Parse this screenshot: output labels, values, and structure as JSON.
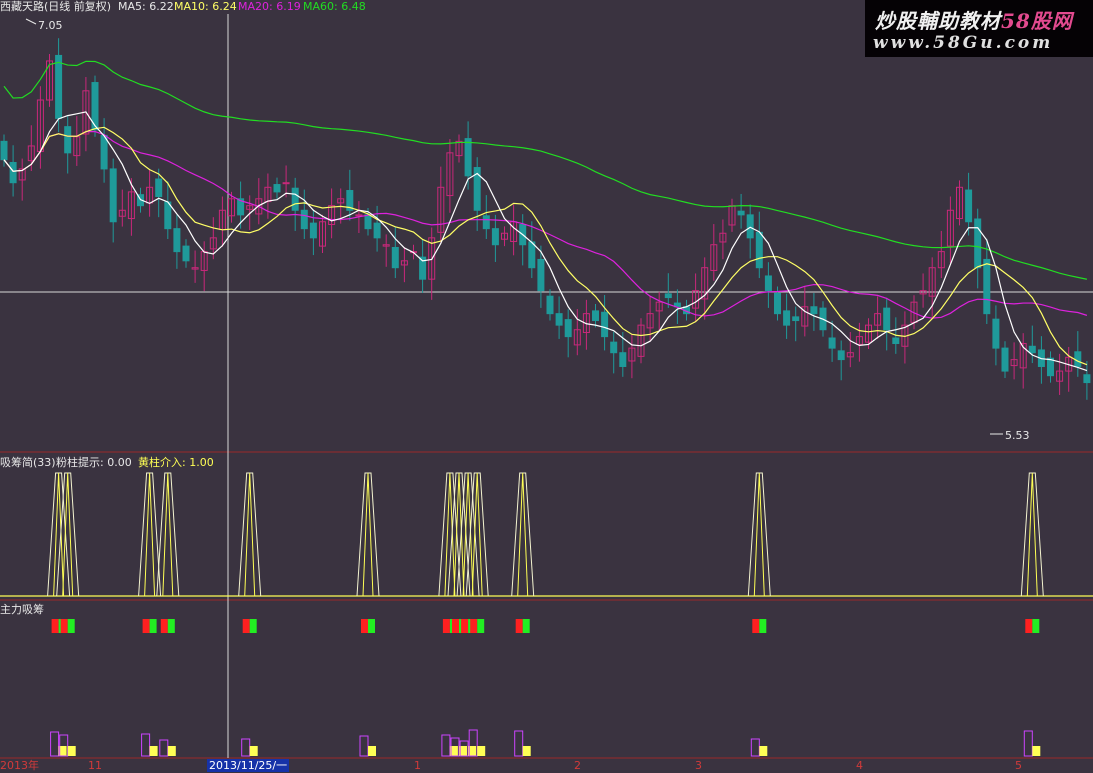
{
  "header": {
    "title": "西藏天路(日线 前复权)",
    "ma5": "MA5: 6.22",
    "ma10": "MA10: 6.24",
    "ma20": "MA20: 6.19",
    "ma60": "MA60: 6.48",
    "high_marker": "7.05",
    "low_marker": "5.53"
  },
  "watermark": {
    "line1_a": "炒股輔助教材",
    "line1_b": "58股网",
    "line2": "www.58Gu.com"
  },
  "panel2": {
    "title": "吸筹简(33)",
    "pink": "粉柱提示: 0.00",
    "yellow": "黄柱介入: 1.00"
  },
  "panel3": {
    "title": "主力吸筹"
  },
  "xaxis": {
    "year": "2013年",
    "m11": "11",
    "cursor_date": "2013/11/25/一",
    "m1": "1",
    "m2": "2",
    "m3": "3",
    "m4": "4",
    "m5": "5"
  },
  "colors": {
    "up": "#c8287a",
    "down": "#1f9a9a",
    "ma5": "#ffffff",
    "ma10": "#ffff66",
    "ma20": "#dd22dd",
    "ma60": "#22dd22",
    "yellow": "#ffff55",
    "red": "#ff2020",
    "green": "#22ee22",
    "purple": "#cc44ff"
  },
  "chart_data": [
    {
      "type": "candlestick",
      "title": "西藏天路(日线 前复权)",
      "ylim": [
        5.3,
        7.15
      ],
      "annotations": {
        "max": 7.05,
        "min": 5.53
      },
      "series": [
        {
          "name": "MA5",
          "value_latest": 6.22
        },
        {
          "name": "MA10",
          "value_latest": 6.24
        },
        {
          "name": "MA20",
          "value_latest": 6.19
        },
        {
          "name": "MA60",
          "value_latest": 6.48
        }
      ],
      "close": [
        6.52,
        6.42,
        6.48,
        6.58,
        6.78,
        6.95,
        6.7,
        6.55,
        6.62,
        6.82,
        6.65,
        6.48,
        6.25,
        6.3,
        6.38,
        6.32,
        6.4,
        6.36,
        6.22,
        6.12,
        6.08,
        6.05,
        6.12,
        6.18,
        6.3,
        6.35,
        6.28,
        6.32,
        6.35,
        6.4,
        6.38,
        6.42,
        6.3,
        6.22,
        6.18,
        6.25,
        6.32,
        6.35,
        6.3,
        6.28,
        6.22,
        6.18,
        6.15,
        6.05,
        6.08,
        6.12,
        6.0,
        6.18,
        6.4,
        6.55,
        6.6,
        6.45,
        6.3,
        6.22,
        6.15,
        6.2,
        6.25,
        6.15,
        6.05,
        5.95,
        5.85,
        5.8,
        5.75,
        5.78,
        5.85,
        5.82,
        5.75,
        5.68,
        5.62,
        5.7,
        5.8,
        5.85,
        5.9,
        5.92,
        5.88,
        5.85,
        5.95,
        6.05,
        6.15,
        6.2,
        6.32,
        6.28,
        6.18,
        6.05,
        5.95,
        5.85,
        5.8,
        5.82,
        5.88,
        5.85,
        5.78,
        5.7,
        5.65,
        5.68,
        5.75,
        5.8,
        5.85,
        5.78,
        5.72,
        5.8,
        5.9,
        5.95,
        6.05,
        6.12,
        6.3,
        6.4,
        6.25,
        6.05,
        5.85,
        5.7,
        5.6,
        5.65,
        5.72,
        5.68,
        5.62,
        5.58,
        5.6,
        5.66,
        5.62,
        5.55
      ],
      "ma_note": "MA lines computed from close values"
    },
    {
      "type": "line",
      "title": "吸筹简(33)",
      "series": [
        {
          "name": "粉柱提示",
          "value_latest": 0.0
        },
        {
          "name": "黄柱介入",
          "value_latest": 1.0
        }
      ],
      "signal_bars": [
        6,
        7,
        16,
        18,
        27,
        40,
        49,
        50,
        51,
        52,
        57,
        83,
        113
      ]
    },
    {
      "type": "bar",
      "title": "主力吸筹",
      "signal_bars": [
        6,
        7,
        16,
        18,
        27,
        40,
        49,
        50,
        51,
        52,
        57,
        83,
        113
      ]
    }
  ]
}
